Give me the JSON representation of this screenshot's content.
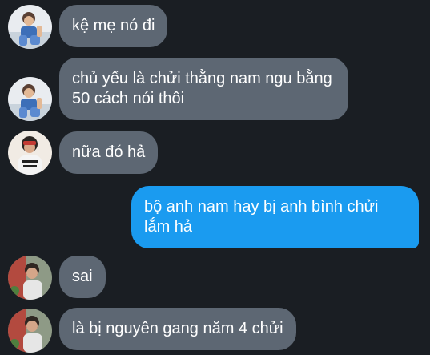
{
  "conversation": {
    "messages": [
      {
        "sender": "user-a",
        "direction": "incoming",
        "text": "kệ mẹ nó đi"
      },
      {
        "sender": "user-a",
        "direction": "incoming",
        "text": "chủ yếu là chửi thằng nam ngu bằng 50 cách nói thôi"
      },
      {
        "sender": "user-b",
        "direction": "incoming",
        "text": "nữa đó hả"
      },
      {
        "sender": "me",
        "direction": "outgoing",
        "text": "bộ anh nam hay bị anh bình chửi lắm hả"
      },
      {
        "sender": "user-c",
        "direction": "incoming",
        "text": "sai"
      },
      {
        "sender": "user-c",
        "direction": "incoming",
        "text": "là bị nguyên gang năm 4 chửi"
      }
    ]
  },
  "colors": {
    "background": "#1a1e23",
    "incoming_bubble": "#5d6773",
    "outgoing_bubble": "#1a9bf0",
    "text": "#ffffff"
  }
}
